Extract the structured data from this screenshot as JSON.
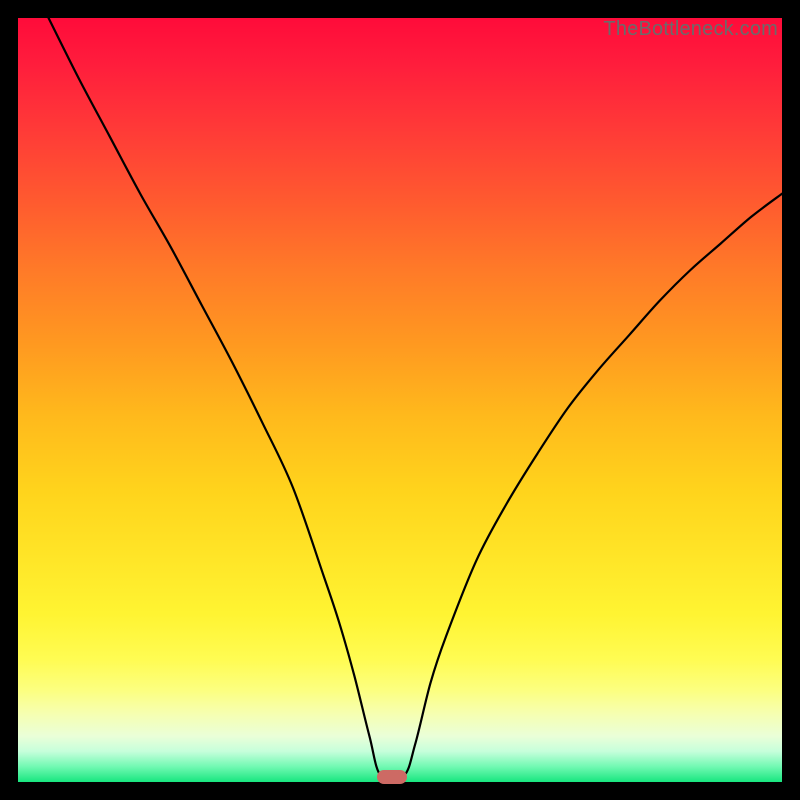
{
  "watermark": "TheBottleneck.com",
  "marker": {
    "x_pct": 49.0,
    "y_pct": 99.3,
    "color": "#cd6a64"
  },
  "chart_data": {
    "type": "line",
    "title": "",
    "xlabel": "",
    "ylabel": "",
    "xlim": [
      0,
      100
    ],
    "ylim": [
      0,
      100
    ],
    "grid": false,
    "legend": false,
    "series": [
      {
        "name": "bottleneck-curve",
        "x": [
          4,
          8,
          12,
          16,
          20,
          24,
          28,
          32,
          36,
          40,
          42,
          44,
          46,
          47.5,
          50.5,
          52,
          54,
          56,
          60,
          64,
          68,
          72,
          76,
          80,
          84,
          88,
          92,
          96,
          100
        ],
        "y": [
          100,
          92,
          84.5,
          77,
          70,
          62.5,
          55,
          47,
          38.5,
          27,
          21,
          14,
          6,
          0.8,
          0.8,
          5,
          13,
          19,
          29,
          36.5,
          43,
          49,
          54,
          58.5,
          63,
          67,
          70.5,
          74,
          77
        ]
      }
    ],
    "background_gradient": {
      "direction": "vertical",
      "stops": [
        {
          "pct": 0,
          "color": "#ff0b3a"
        },
        {
          "pct": 50,
          "color": "#ffc41c"
        },
        {
          "pct": 85,
          "color": "#fffc53"
        },
        {
          "pct": 100,
          "color": "#18e67f"
        }
      ]
    }
  }
}
